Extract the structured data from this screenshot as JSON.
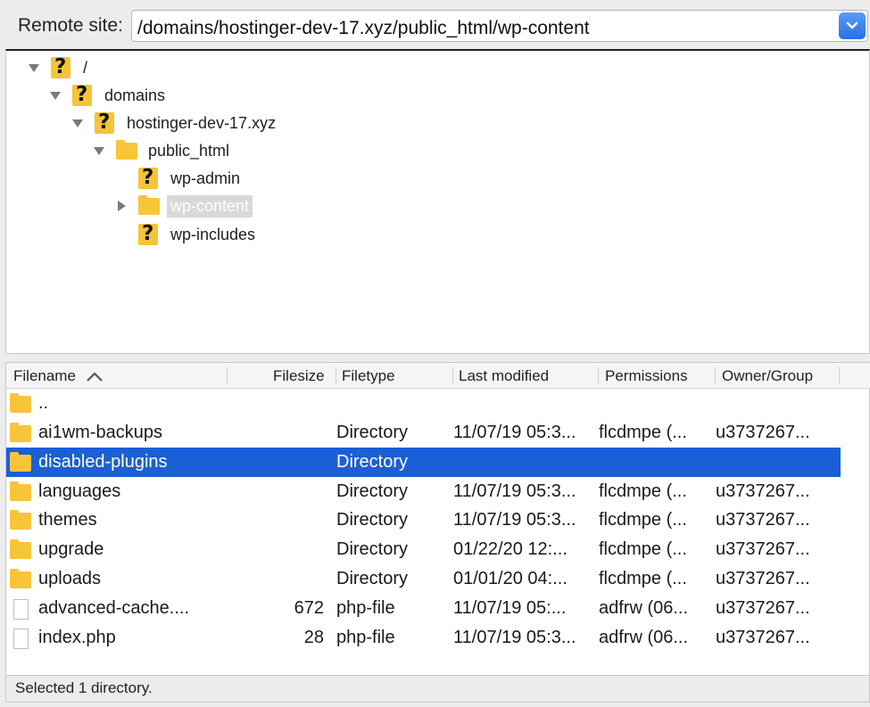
{
  "remote_site": {
    "label": "Remote site:",
    "path": "/domains/hostinger-dev-17.xyz/public_html/wp-content"
  },
  "tree": [
    {
      "label": "/",
      "icon": "unknown-folder-icon",
      "expanded": true
    },
    {
      "label": "domains",
      "icon": "unknown-folder-icon",
      "expanded": true
    },
    {
      "label": "hostinger-dev-17.xyz",
      "icon": "unknown-folder-icon",
      "expanded": true
    },
    {
      "label": "public_html",
      "icon": "folder-icon",
      "expanded": true
    },
    {
      "label": "wp-admin",
      "icon": "unknown-folder-icon"
    },
    {
      "label": "wp-content",
      "icon": "folder-icon",
      "expanded": false,
      "selected": true
    },
    {
      "label": "wp-includes",
      "icon": "unknown-folder-icon"
    }
  ],
  "columns": {
    "filename": "Filename",
    "filesize": "Filesize",
    "filetype": "Filetype",
    "modified": "Last modified",
    "permissions": "Permissions",
    "owner": "Owner/Group"
  },
  "files": [
    {
      "name": "..",
      "size": "",
      "type": "",
      "modified": "",
      "permissions": "",
      "owner": "",
      "icon": "folder-icon"
    },
    {
      "name": "ai1wm-backups",
      "size": "",
      "type": "Directory",
      "modified": "11/07/19 05:3...",
      "permissions": "flcdmpe (...",
      "owner": "u3737267...",
      "icon": "folder-icon"
    },
    {
      "name": "disabled-plugins",
      "size": "",
      "type": "Directory",
      "modified": "",
      "permissions": "",
      "owner": "",
      "icon": "folder-icon",
      "selected": true
    },
    {
      "name": "languages",
      "size": "",
      "type": "Directory",
      "modified": "11/07/19 05:3...",
      "permissions": "flcdmpe (...",
      "owner": "u3737267...",
      "icon": "folder-icon"
    },
    {
      "name": "themes",
      "size": "",
      "type": "Directory",
      "modified": "11/07/19 05:3...",
      "permissions": "flcdmpe (...",
      "owner": "u3737267...",
      "icon": "folder-icon"
    },
    {
      "name": "upgrade",
      "size": "",
      "type": "Directory",
      "modified": "01/22/20 12:...",
      "permissions": "flcdmpe (...",
      "owner": "u3737267...",
      "icon": "folder-icon"
    },
    {
      "name": "uploads",
      "size": "",
      "type": "Directory",
      "modified": "01/01/20 04:...",
      "permissions": "flcdmpe (...",
      "owner": "u3737267...",
      "icon": "folder-icon"
    },
    {
      "name": "advanced-cache....",
      "size": "672",
      "type": "php-file",
      "modified": "11/07/19 05:...",
      "permissions": "adfrw (06...",
      "owner": "u3737267...",
      "icon": "file-icon"
    },
    {
      "name": "index.php",
      "size": "28",
      "type": "php-file",
      "modified": "11/07/19 05:3...",
      "permissions": "adfrw (06...",
      "owner": "u3737267...",
      "icon": "file-icon"
    }
  ],
  "status": "Selected 1 directory.",
  "colors": {
    "selection": "#1a5fd6",
    "folder": "#f6c53a"
  }
}
